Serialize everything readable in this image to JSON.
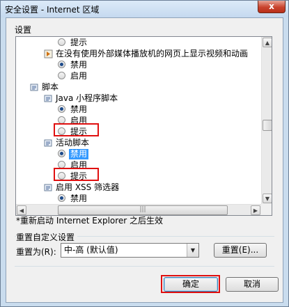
{
  "window": {
    "title": "安全设置 - Internet 区域",
    "close_label": "x"
  },
  "settings": {
    "label": "设置",
    "items": [
      {
        "kind": "radio",
        "label": "提示",
        "checked": false
      },
      {
        "kind": "category",
        "icon": "media-policy-icon",
        "label": "在没有使用外部媒体播放机的网页上显示视频和动画"
      },
      {
        "kind": "radio",
        "label": "禁用",
        "checked": true
      },
      {
        "kind": "radio",
        "label": "启用",
        "checked": false
      },
      {
        "kind": "heading",
        "icon": "script-category-icon",
        "label": "脚本"
      },
      {
        "kind": "category",
        "icon": "settings-icon",
        "label": "Java 小程序脚本"
      },
      {
        "kind": "radio",
        "label": "禁用",
        "checked": true
      },
      {
        "kind": "radio",
        "label": "启用",
        "checked": false
      },
      {
        "kind": "radio",
        "label": "提示",
        "checked": false
      },
      {
        "kind": "category",
        "icon": "settings-icon",
        "label": "活动脚本"
      },
      {
        "kind": "radio",
        "label": "禁用",
        "checked": true,
        "selected": true
      },
      {
        "kind": "radio",
        "label": "启用",
        "checked": false
      },
      {
        "kind": "radio",
        "label": "提示",
        "checked": false
      },
      {
        "kind": "category",
        "icon": "settings-icon",
        "label": "启用 XSS 筛选器"
      },
      {
        "kind": "radio",
        "label": "禁用",
        "checked": true
      }
    ]
  },
  "note": "*重新启动 Internet Explorer 之后生效",
  "reset": {
    "group_label": "重置自定义设置",
    "reset_to_label": "重置为(R):",
    "selected_level": "中-高 (默认值)",
    "reset_button": "重置(E)..."
  },
  "footer": {
    "ok_label": "确定",
    "cancel_label": "取消"
  },
  "colors": {
    "highlight": "#e01010",
    "selection": "#3399ff"
  }
}
